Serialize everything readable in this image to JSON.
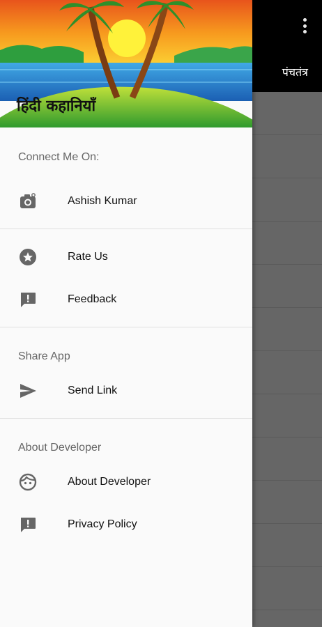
{
  "app_background": {
    "tab_label": "पंचतंत्र",
    "menu_icon": "more-vertical-icon"
  },
  "drawer": {
    "header_title": "हिंदी कहानियाँ",
    "sections": [
      {
        "title": "Connect Me On:",
        "items": [
          {
            "label": "Ashish Kumar",
            "icon": "instagram-camera-icon"
          }
        ]
      },
      {
        "title": "",
        "items": [
          {
            "label": "Rate Us",
            "icon": "star-circle-icon"
          },
          {
            "label": "Feedback",
            "icon": "feedback-icon"
          }
        ]
      },
      {
        "title": "Share App",
        "items": [
          {
            "label": "Send Link",
            "icon": "send-icon"
          }
        ]
      },
      {
        "title": "About Developer",
        "items": [
          {
            "label": "About Developer",
            "icon": "face-icon"
          },
          {
            "label": "Privacy Policy",
            "icon": "feedback-icon"
          }
        ]
      }
    ]
  },
  "colors": {
    "icon": "#666666",
    "text": "#111111",
    "section_title": "#666666",
    "drawer_bg": "#fafafa",
    "toolbar": "#000000"
  }
}
